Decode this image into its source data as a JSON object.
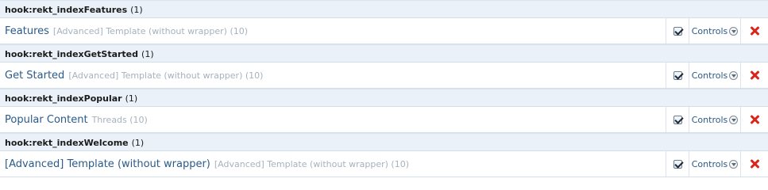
{
  "groups": [
    {
      "hook_name": "hook:rekt_indexFeatures",
      "hook_count": "(1)",
      "item": {
        "title": "Features",
        "meta": "[Advanced] Template (without wrapper) (10)",
        "controls_label": "Controls",
        "enabled": true
      }
    },
    {
      "hook_name": "hook:rekt_indexGetStarted",
      "hook_count": "(1)",
      "item": {
        "title": "Get Started",
        "meta": "[Advanced] Template (without wrapper) (10)",
        "controls_label": "Controls",
        "enabled": true
      }
    },
    {
      "hook_name": "hook:rekt_indexPopular",
      "hook_count": "(1)",
      "item": {
        "title": "Popular Content",
        "meta": "Threads (10)",
        "controls_label": "Controls",
        "enabled": true
      }
    },
    {
      "hook_name": "hook:rekt_indexWelcome",
      "hook_count": "(1)",
      "item": {
        "title": "[Advanced] Template (without wrapper)",
        "meta": "[Advanced] Template (without wrapper) (10)",
        "controls_label": "Controls",
        "enabled": true
      }
    }
  ],
  "colors": {
    "link": "#2a5a8a",
    "meta": "#a7b2bd",
    "header_bg": "#eaf1f8",
    "delete": "#d9261c"
  },
  "icons": {
    "checkbox": "checkbox-checked-icon",
    "controls": "chevron-down-circle-icon",
    "delete": "delete-x-icon"
  }
}
